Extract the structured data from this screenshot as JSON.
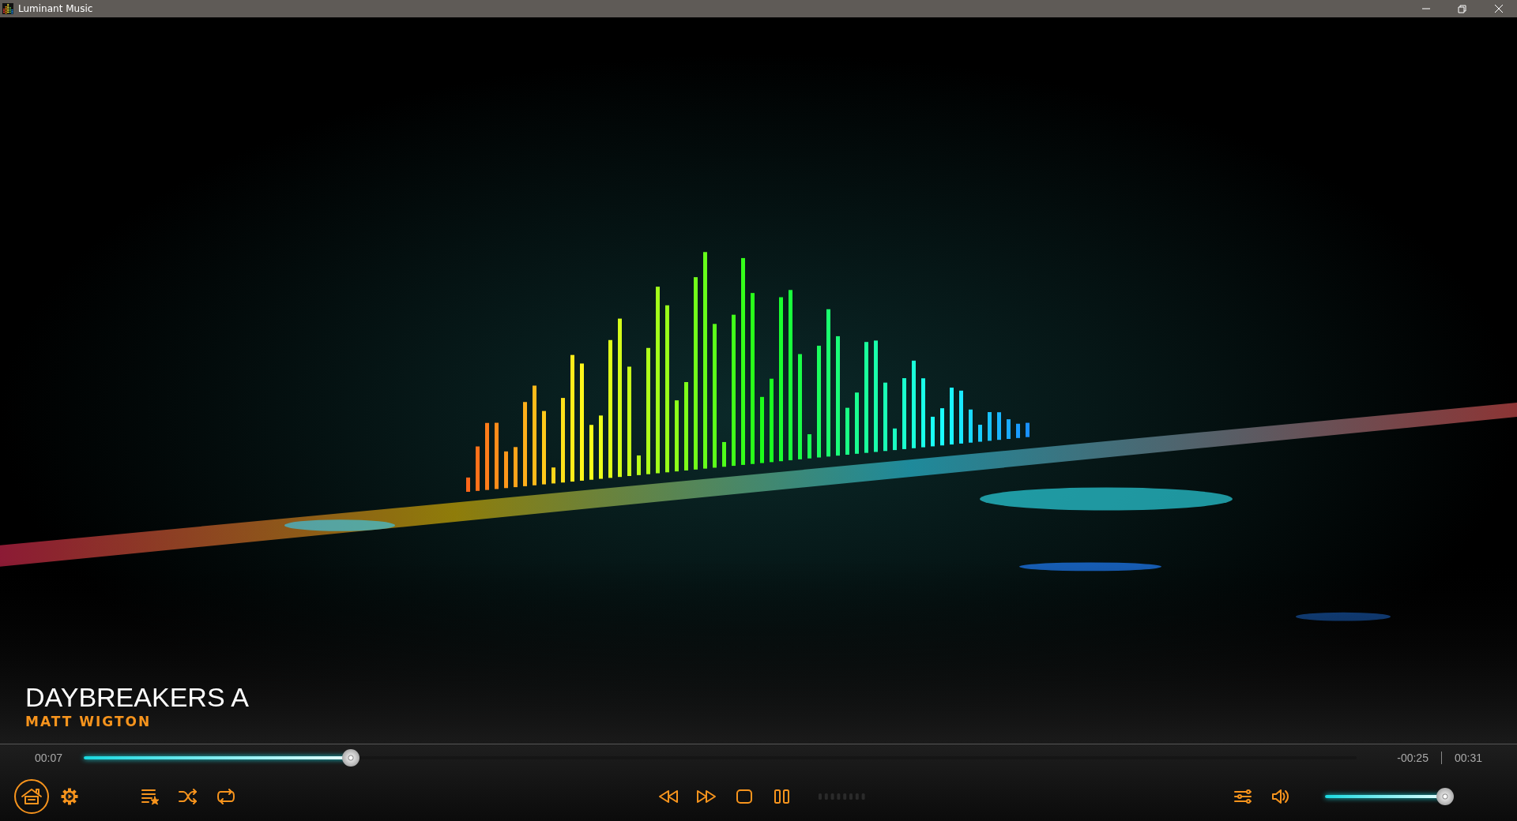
{
  "window": {
    "title": "Luminant Music"
  },
  "now_playing": {
    "title": "DAYBREAKERS A",
    "artist": "MATT WIGTON"
  },
  "seek": {
    "elapsed": "00:07",
    "level": 0.21,
    "remaining": "-00:25",
    "total": "00:31"
  },
  "left_buttons": [
    {
      "kind": "home",
      "active": true
    },
    {
      "kind": "settings",
      "active": false
    },
    {
      "kind": "playlist",
      "active": false
    },
    {
      "kind": "shuffle",
      "active": false
    },
    {
      "kind": "repeat",
      "active": false
    }
  ],
  "center_buttons": [
    {
      "kind": "rewind"
    },
    {
      "kind": "forward"
    },
    {
      "kind": "stop"
    },
    {
      "kind": "pause"
    }
  ],
  "right_buttons": [
    {
      "kind": "equalizer"
    },
    {
      "kind": "volume"
    }
  ],
  "volume": {
    "level": 1
  }
}
